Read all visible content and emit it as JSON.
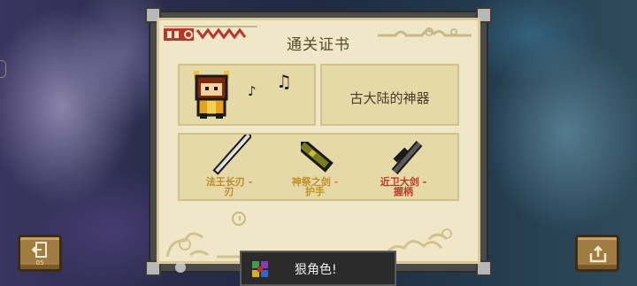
{
  "certificate": {
    "title": "通关证书",
    "achievement": "古大陆的神器",
    "notes": [
      "♪",
      "♫"
    ],
    "items": [
      {
        "name": "法王长刃 - 刃",
        "label_lines": [
          "法王长刃 -",
          "刃"
        ],
        "icon": "sword-blade-icon"
      },
      {
        "name": "神祭之剑 - 护手",
        "label_lines": [
          "神祭之剑 -",
          "护手"
        ],
        "icon": "sword-guard-icon"
      },
      {
        "name": "近卫大剑 - 握柄",
        "label_lines": [
          "近卫大剑 -",
          "握柄"
        ],
        "icon": "sword-hilt-icon"
      }
    ]
  },
  "buttons": {
    "exit": {
      "sub": "05",
      "icon": "exit-icon"
    },
    "share": {
      "icon": "share-icon"
    }
  },
  "toast": {
    "text": "狠角色!",
    "icon": "character-icon"
  },
  "colors": {
    "paper": "#f0e7c8",
    "panel": "#e6d9a8",
    "frame": "#4a4a4a",
    "button": "#a07c42",
    "toast": "#2b2b2b",
    "label_gold": "#c28f26",
    "label_red": "#c0392b"
  }
}
